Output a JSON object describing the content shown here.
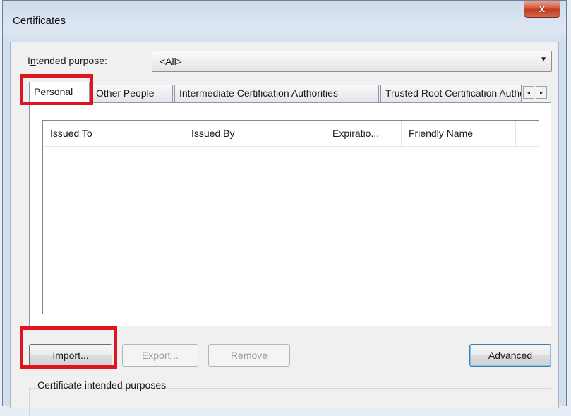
{
  "window": {
    "title": "Certificates",
    "close_glyph": "x"
  },
  "purpose": {
    "label_prefix": "I",
    "label_underlined": "n",
    "label_rest": "tended purpose:",
    "selected": "<All>"
  },
  "tabs": [
    {
      "label": "Personal",
      "active": true
    },
    {
      "label": "Other People",
      "active": false
    },
    {
      "label": "Intermediate Certification Authorities",
      "active": false
    },
    {
      "label": "Trusted Root Certification Authorities",
      "active": false
    }
  ],
  "tab_scroll": {
    "left": "◂",
    "right": "▸"
  },
  "list": {
    "columns": [
      "Issued To",
      "Issued By",
      "Expiratio...",
      "Friendly Name"
    ]
  },
  "buttons": {
    "import": "Import...",
    "export": "Export...",
    "remove": "Remove",
    "advanced": "Advanced"
  },
  "group": {
    "label": "Certificate intended purposes"
  },
  "colors": {
    "highlight": "#e0141e",
    "close_button": "#c23b22"
  }
}
